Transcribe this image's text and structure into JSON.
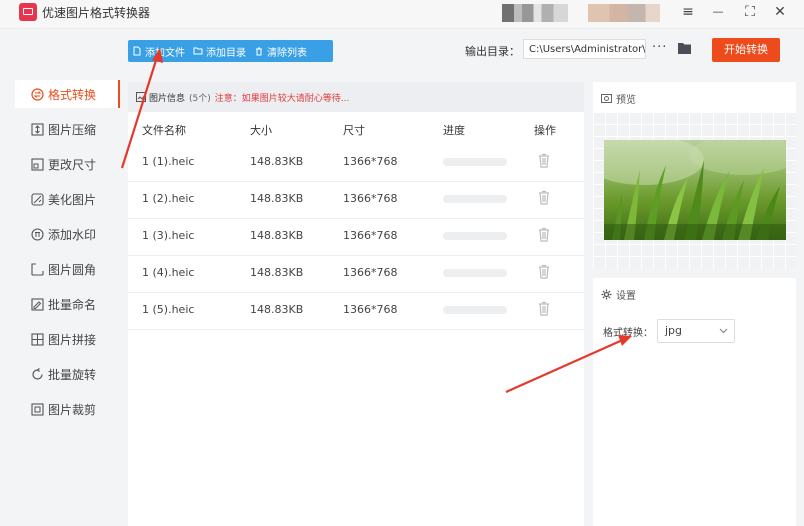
{
  "app": {
    "title": "优速图片格式转换器"
  },
  "window_controls": {
    "menu": "≡",
    "minimize": "—",
    "maximize": "⛶",
    "close": "✕"
  },
  "toolbar": {
    "add_file": "添加文件",
    "add_folder": "添加目录",
    "clear_list": "清除列表",
    "output_label": "输出目录：",
    "output_path": "C:\\Users\\Administrator\\",
    "more": "···",
    "start": "开始转换"
  },
  "sidebar": {
    "items": [
      {
        "label": "格式转换",
        "icon": "format-convert-icon",
        "active": true
      },
      {
        "label": "图片压缩",
        "icon": "compress-icon"
      },
      {
        "label": "更改尺寸",
        "icon": "resize-icon"
      },
      {
        "label": "美化图片",
        "icon": "beautify-icon"
      },
      {
        "label": "添加水印",
        "icon": "watermark-icon"
      },
      {
        "label": "图片圆角",
        "icon": "round-corner-icon"
      },
      {
        "label": "批量命名",
        "icon": "rename-icon"
      },
      {
        "label": "图片拼接",
        "icon": "stitch-icon"
      },
      {
        "label": "批量旋转",
        "icon": "rotate-icon"
      },
      {
        "label": "图片裁剪",
        "icon": "crop-icon"
      }
    ]
  },
  "file_list": {
    "info_title": "图片信息",
    "info_count": "(5个)",
    "notice": "注意：如果图片较大请耐心等待...",
    "columns": {
      "name": "文件名称",
      "size": "大小",
      "dimensions": "尺寸",
      "progress": "进度",
      "actions": "操作"
    },
    "rows": [
      {
        "name": "1 (1).heic",
        "size": "148.83KB",
        "dimensions": "1366*768",
        "progress": 0
      },
      {
        "name": "1 (2).heic",
        "size": "148.83KB",
        "dimensions": "1366*768",
        "progress": 0
      },
      {
        "name": "1 (3).heic",
        "size": "148.83KB",
        "dimensions": "1366*768",
        "progress": 0
      },
      {
        "name": "1 (4).heic",
        "size": "148.83KB",
        "dimensions": "1366*768",
        "progress": 0
      },
      {
        "name": "1 (5).heic",
        "size": "148.83KB",
        "dimensions": "1366*768",
        "progress": 0
      }
    ]
  },
  "preview": {
    "title": "预览"
  },
  "settings": {
    "title": "设置",
    "format_label": "格式转换：",
    "format_value": "jpg"
  },
  "colors": {
    "accent": "#e84e1b",
    "toolbar_blue": "#3aa0e6",
    "start_button": "#ee4b1c",
    "notice_red": "#e03b3b",
    "annotation_arrow": "#e33a2c"
  }
}
